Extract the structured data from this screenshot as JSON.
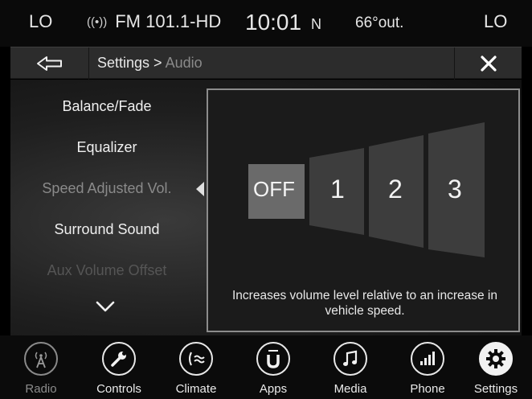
{
  "status": {
    "lo_left": "LO",
    "lo_right": "LO",
    "radio_source": "FM 101.1-HD",
    "clock": "10:01",
    "compass": "N",
    "temperature": "66°out."
  },
  "header": {
    "breadcrumb_current": "Settings > ",
    "breadcrumb_sub": "Audio"
  },
  "menu": {
    "items": [
      {
        "label": "Balance/Fade"
      },
      {
        "label": "Equalizer"
      },
      {
        "label": "Speed Adjusted Vol."
      },
      {
        "label": "Surround Sound"
      },
      {
        "label": "Aux Volume Offset"
      }
    ]
  },
  "panel": {
    "levels": [
      "OFF",
      "1",
      "2",
      "3"
    ],
    "selected_level": "OFF",
    "description": "Increases volume level relative to an increase in vehicle speed."
  },
  "nav": {
    "items": [
      {
        "label": "Radio",
        "icon": "radio-antenna-icon"
      },
      {
        "label": "Controls",
        "icon": "wrench-icon"
      },
      {
        "label": "Climate",
        "icon": "climate-fan-icon"
      },
      {
        "label": "Apps",
        "icon": "uconnect-apps-icon"
      },
      {
        "label": "Media",
        "icon": "music-note-icon"
      },
      {
        "label": "Phone",
        "icon": "phone-signal-icon"
      },
      {
        "label": "Settings",
        "icon": "gear-icon"
      }
    ]
  },
  "colors": {
    "selected_level_fill": "#6a6a6a",
    "level_fill": "#3d3d3d",
    "panel_border": "#8c8c8c"
  }
}
